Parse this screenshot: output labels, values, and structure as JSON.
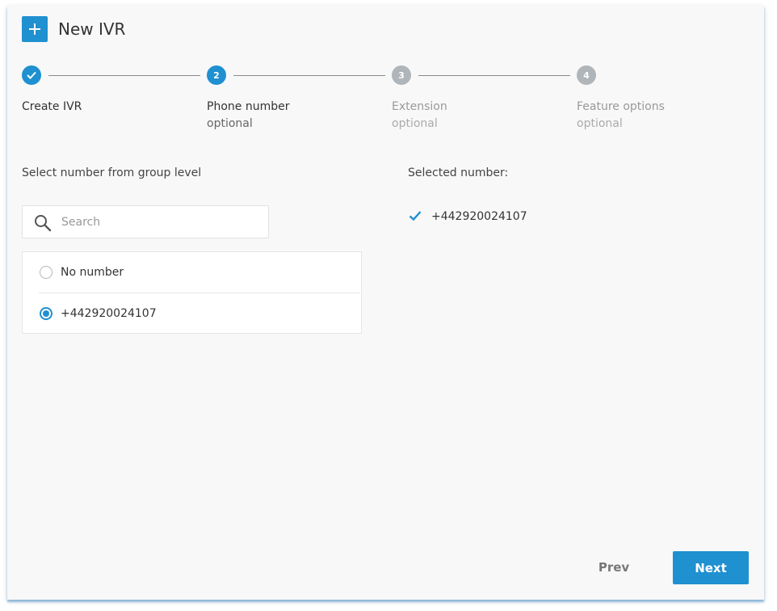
{
  "header": {
    "title": "New IVR",
    "icon": "plus-icon"
  },
  "stepper": {
    "steps": [
      {
        "label": "Create IVR",
        "sub": "",
        "marker": "",
        "state": "completed"
      },
      {
        "label": "Phone number",
        "sub": "optional",
        "marker": "2",
        "state": "active"
      },
      {
        "label": "Extension",
        "sub": "optional",
        "marker": "3",
        "state": "pending"
      },
      {
        "label": "Feature options",
        "sub": "optional",
        "marker": "4",
        "state": "pending"
      }
    ]
  },
  "left": {
    "label": "Select number from group level",
    "search": {
      "placeholder": "Search",
      "value": ""
    },
    "options": [
      {
        "label": "No number",
        "checked": false
      },
      {
        "label": "+442920024107",
        "checked": true
      }
    ]
  },
  "right": {
    "label": "Selected number:",
    "value": "+442920024107"
  },
  "footer": {
    "prev_label": "Prev",
    "next_label": "Next"
  },
  "colors": {
    "accent": "#1f90d0",
    "pending": "#b0b5ba",
    "background": "#f8f8f8"
  }
}
